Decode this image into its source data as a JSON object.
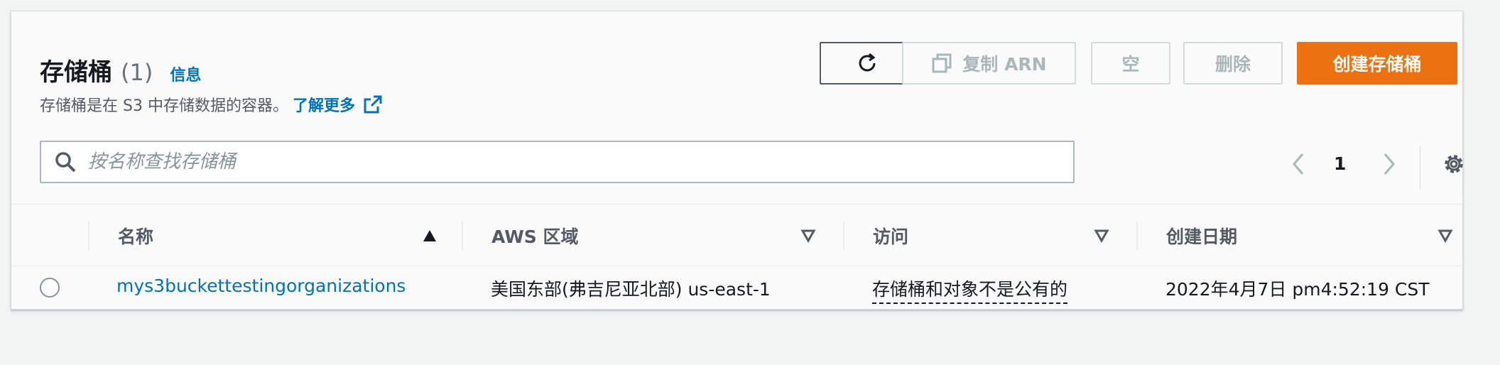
{
  "header": {
    "title": "存储桶",
    "count": "(1)",
    "info_link": "信息",
    "description": "存储桶是在 S3 中存储数据的容器。",
    "learn_more": "了解更多"
  },
  "toolbar": {
    "copy_arn_label": "复制 ARN",
    "empty_label": "空",
    "delete_label": "删除",
    "create_label": "创建存储桶"
  },
  "search": {
    "placeholder": "按名称查找存储桶",
    "value": ""
  },
  "pagination": {
    "current_page": "1"
  },
  "table": {
    "columns": [
      "名称",
      "AWS 区域",
      "访问",
      "创建日期"
    ],
    "rows": [
      {
        "name": "mys3buckettestingorganizations",
        "region": "美国东部(弗吉尼亚北部) us-east-1",
        "access": "存储桶和对象不是公有的",
        "created": "2022年4月7日 pm4:52:19 CST"
      }
    ]
  },
  "colors": {
    "accent_orange": "#ec7211",
    "link_blue": "#0073bb"
  },
  "icons": [
    "refresh-icon",
    "copy-icon",
    "external-link-icon",
    "search-icon",
    "chevron-left-icon",
    "chevron-right-icon",
    "settings-gear-icon",
    "sort-ascending-icon",
    "sort-descending-icon"
  ]
}
